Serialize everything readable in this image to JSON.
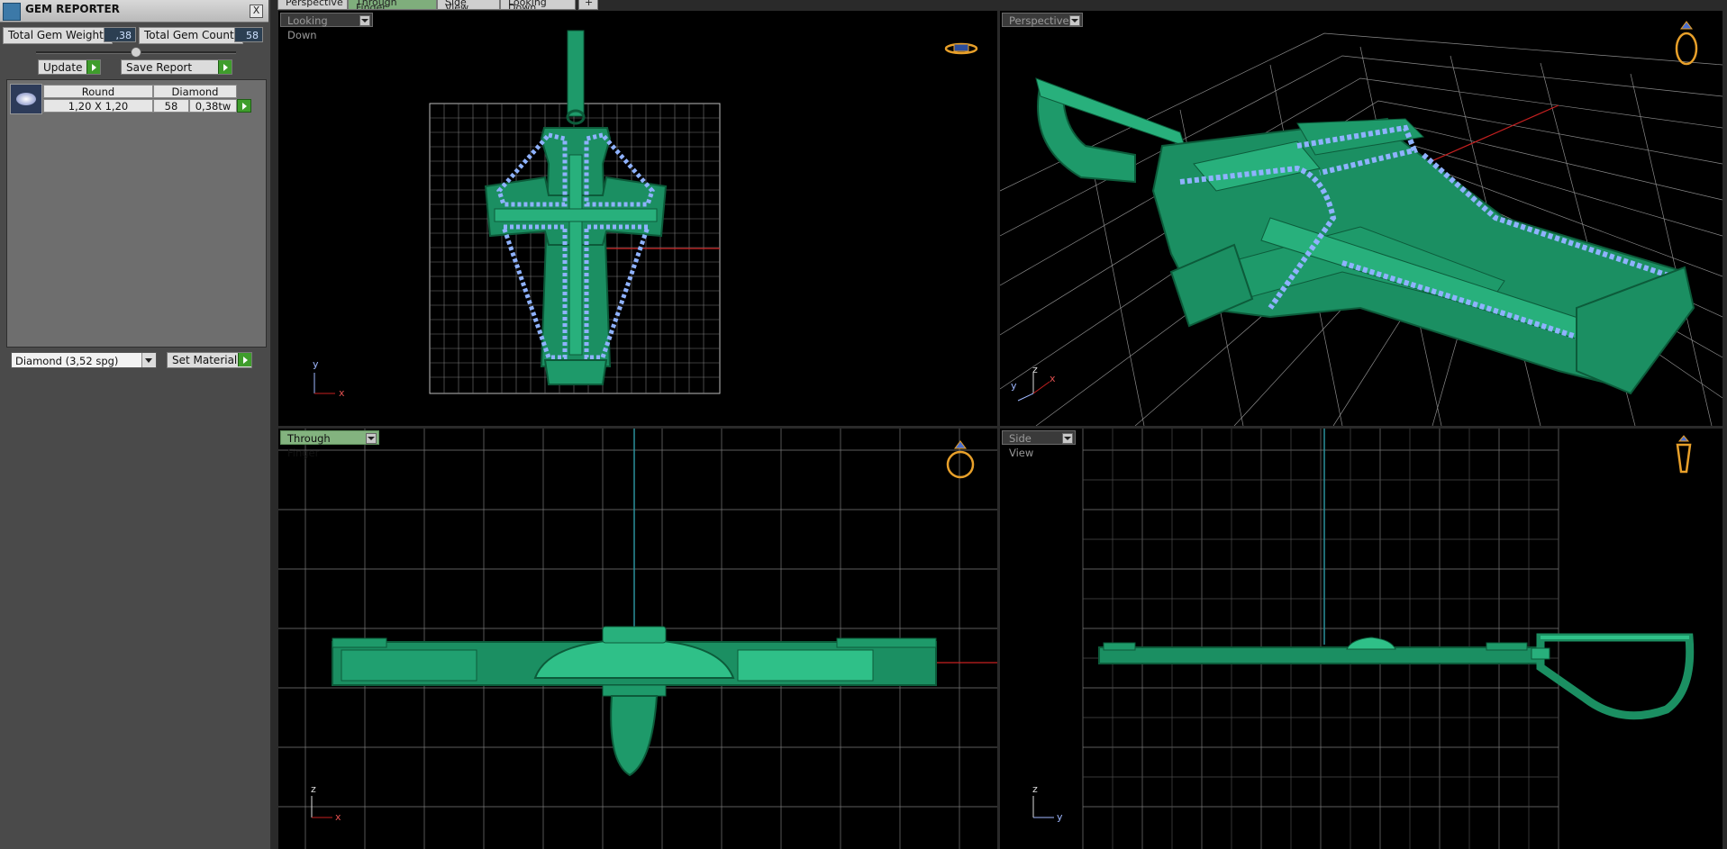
{
  "gem_reporter": {
    "title": "GEM REPORTER",
    "close_label": "X",
    "total_weight_label": "Total Gem Weight",
    "total_weight_value": ",38",
    "total_count_label": "Total Gem Count",
    "total_count_value": "58",
    "update_label": "Update",
    "save_report_label": "Save Report",
    "gem_list": {
      "columns": [
        "Round",
        "Diamond"
      ],
      "row": {
        "size": "1,20 X 1,20",
        "count": "58",
        "weight": "0,38tw"
      }
    },
    "material_select": "Diamond    (3,52 spg)",
    "set_material_label": "Set Material"
  },
  "tabs": [
    {
      "label": "Perspective",
      "active": false
    },
    {
      "label": "Through Finger",
      "active": true
    },
    {
      "label": "Side View",
      "active": false
    },
    {
      "label": "Looking Down",
      "active": false
    },
    {
      "label": "+",
      "active": false
    }
  ],
  "viewports": {
    "top_left": {
      "label": "Looking Down",
      "axes": [
        "y",
        "x"
      ]
    },
    "top_right": {
      "label": "Perspective",
      "axes": [
        "z",
        "y",
        "x"
      ]
    },
    "bottom_left": {
      "label": "Through Finger",
      "axes": [
        "z",
        "x"
      ]
    },
    "bottom_right": {
      "label": "Side View",
      "axes": [
        "z",
        "y"
      ]
    }
  },
  "colors": {
    "model_green": "#1e9a6a",
    "gem_blue": "#8fb2ff",
    "grid": "#8a8a8a",
    "axis_red": "#c62020",
    "axis_cyan": "#2a8f9a",
    "ring_icon": "#e8a02a"
  }
}
